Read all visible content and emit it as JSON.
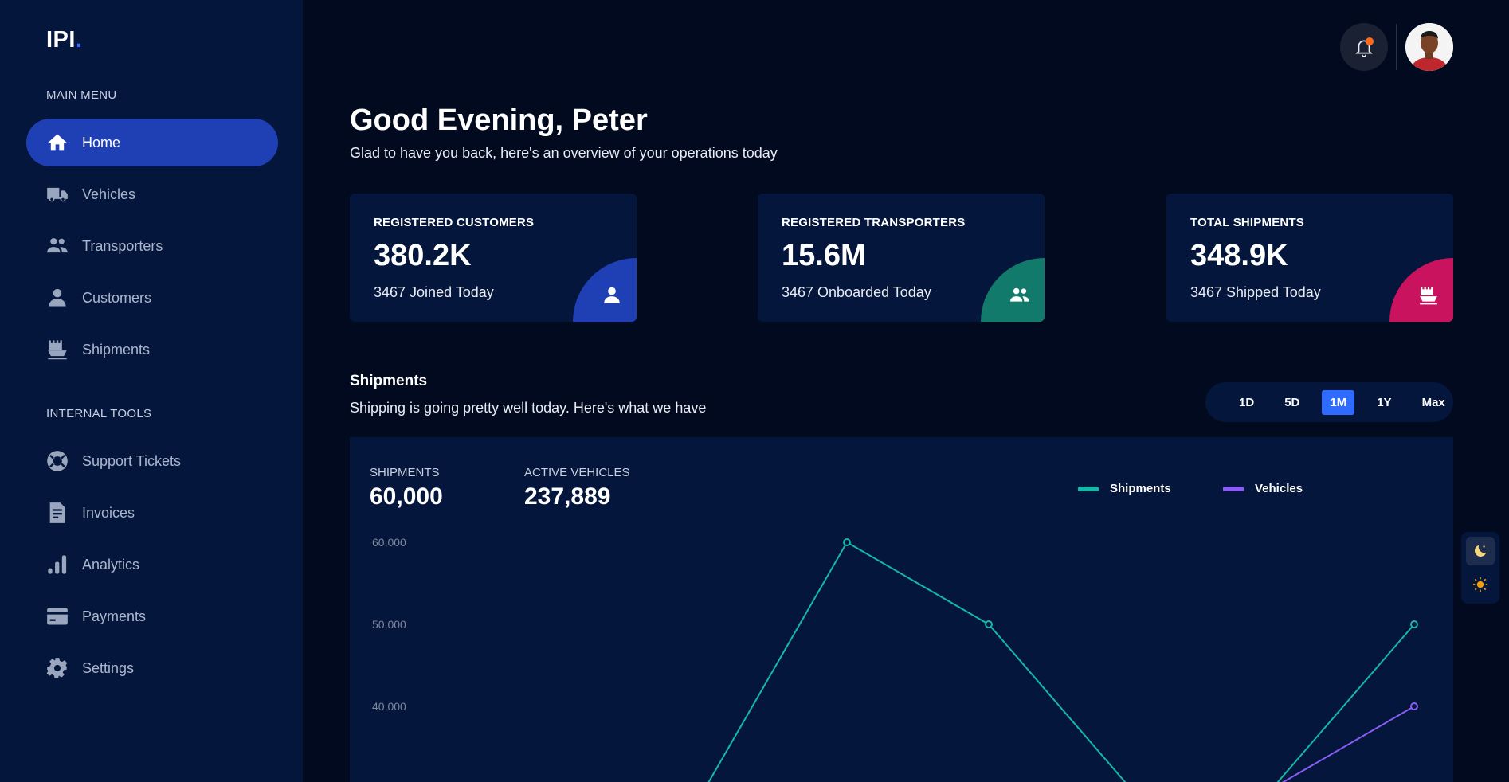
{
  "app": {
    "logo": "IPI",
    "logo_dot": "."
  },
  "sidebar": {
    "main_menu_label": "MAIN MENU",
    "main_items": [
      {
        "label": "Home",
        "icon": "home-icon",
        "active": true
      },
      {
        "label": "Vehicles",
        "icon": "truck-icon"
      },
      {
        "label": "Transporters",
        "icon": "users-icon"
      },
      {
        "label": "Customers",
        "icon": "user-icon"
      },
      {
        "label": "Shipments",
        "icon": "ship-icon"
      }
    ],
    "tools_label": "INTERNAL TOOLS",
    "tool_items": [
      {
        "label": "Support Tickets",
        "icon": "lifebuoy-icon"
      },
      {
        "label": "Invoices",
        "icon": "invoice-icon"
      },
      {
        "label": "Analytics",
        "icon": "analytics-icon"
      },
      {
        "label": "Payments",
        "icon": "credit-card-icon"
      },
      {
        "label": "Settings",
        "icon": "gear-icon"
      }
    ]
  },
  "header": {
    "greeting": "Good Evening, Peter",
    "subtitle": "Glad to have you back, here's an overview of your operations today"
  },
  "stats": [
    {
      "title": "REGISTERED CUSTOMERS",
      "value": "380.2K",
      "note": "3467 Joined Today",
      "color": "#1f3fb4",
      "icon": "user-icon"
    },
    {
      "title": "REGISTERED TRANSPORTERS",
      "value": "15.6M",
      "note": "3467 Onboarded Today",
      "color": "#127a6b",
      "icon": "users-icon"
    },
    {
      "title": "TOTAL SHIPMENTS",
      "value": "348.9K",
      "note": "3467 Shipped Today",
      "color": "#c9135e",
      "icon": "ship-icon"
    }
  ],
  "shipments": {
    "title": "Shipments",
    "subtitle": "Shipping is going pretty well today. Here's what we have",
    "ranges": [
      "1D",
      "5D",
      "1M",
      "1Y",
      "Max"
    ],
    "selected_range": "1M",
    "metrics": [
      {
        "label": "SHIPMENTS",
        "value": "60,000"
      },
      {
        "label": "ACTIVE VEHICLES",
        "value": "237,889"
      }
    ]
  },
  "colors": {
    "shipments": "#14b8a6",
    "vehicles": "#8b5cf6",
    "accent": "#2f6bff"
  },
  "chart_data": {
    "type": "line",
    "title": "",
    "xlabel": "",
    "ylabel": "",
    "y_ticks": [
      "60,000",
      "50,000",
      "40,000"
    ],
    "ylim_visible": [
      30000,
      60000
    ],
    "legend": [
      "Shipments",
      "Vehicles"
    ],
    "legend_position": "top-right",
    "grid": false,
    "series": [
      {
        "name": "Shipments",
        "x": [
          1,
          2,
          3,
          4,
          5,
          6,
          7,
          8
        ],
        "values": [
          null,
          null,
          30000,
          60000,
          50000,
          30000,
          30000,
          50000
        ]
      },
      {
        "name": "Vehicles",
        "x": [
          1,
          2,
          3,
          4,
          5,
          6,
          7,
          8
        ],
        "values": [
          null,
          null,
          null,
          null,
          null,
          null,
          30000,
          40000
        ]
      }
    ]
  }
}
